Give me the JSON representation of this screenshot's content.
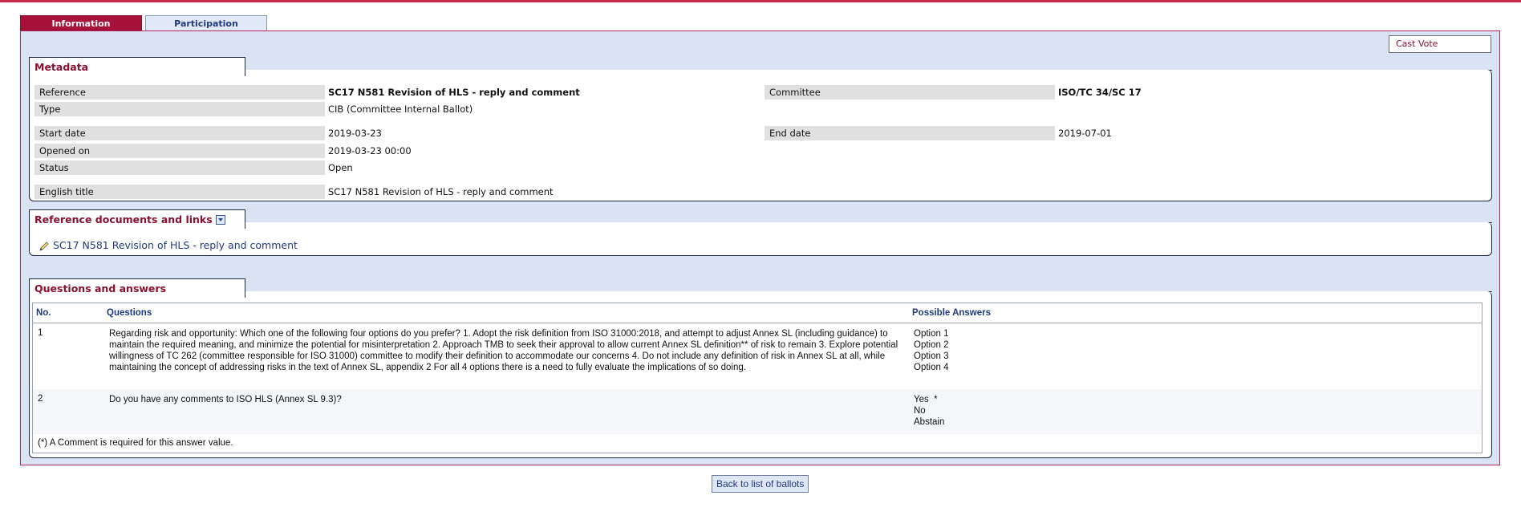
{
  "tabs": [
    {
      "label": "Information",
      "active": true
    },
    {
      "label": "Participation",
      "active": false
    }
  ],
  "actions": {
    "cast_vote": "Cast Vote",
    "back": "Back to list of ballots"
  },
  "metadata": {
    "title": "Metadata",
    "reference_label": "Reference",
    "reference_value": "SC17 N581 Revision of HLS - reply and comment",
    "committee_label": "Committee",
    "committee_value": "ISO/TC 34/SC 17",
    "type_label": "Type",
    "type_value": "CIB  (Committee Internal Ballot)",
    "start_label": "Start date",
    "start_value": "2019-03-23",
    "end_label": "End date",
    "end_value": "2019-07-01",
    "opened_label": "Opened on",
    "opened_value": "2019-03-23 00:00",
    "status_label": "Status",
    "status_value": "Open",
    "english_title_label": "English title",
    "english_title_value": "SC17 N581 Revision of HLS - reply and comment"
  },
  "reference_docs": {
    "title": "Reference documents and links",
    "link": "SC17 N581 Revision of HLS - reply and comment"
  },
  "qa": {
    "title": "Questions and answers",
    "headers": {
      "no": "No.",
      "questions": "Questions",
      "answers": "Possible Answers"
    },
    "rows": [
      {
        "no": "1",
        "question": "Regarding risk and opportunity: Which one of the following four options do you prefer? 1. Adopt the risk definition from ISO 31000:2018, and attempt to adjust Annex SL (including guidance) to maintain the required meaning, and minimize the potential for misinterpretation 2. Approach TMB to seek their approval to allow current Annex SL definition** of risk to remain 3. Explore potential willingness of TC 262 (committee responsible for ISO 31000) committee to modify their definition to accommodate our concerns 4. Do not include any definition of risk in Annex SL at all, while maintaining the concept of addressing risks in the text of Annex SL, appendix 2 For all 4 options there is a need to fully evaluate the implications of so doing.",
        "answers": [
          "Option 1",
          "Option 2",
          "Option 3",
          "Option 4"
        ]
      },
      {
        "no": "2",
        "question": "Do you have any comments to ISO HLS (Annex SL 9.3)?",
        "answers": [
          "Yes  *",
          "No",
          "Abstain"
        ]
      }
    ],
    "note": "(*) A Comment is required for this answer value."
  },
  "colors": {
    "accent": "#a8113a",
    "background": "#dae3f3",
    "link": "#223a7a"
  }
}
